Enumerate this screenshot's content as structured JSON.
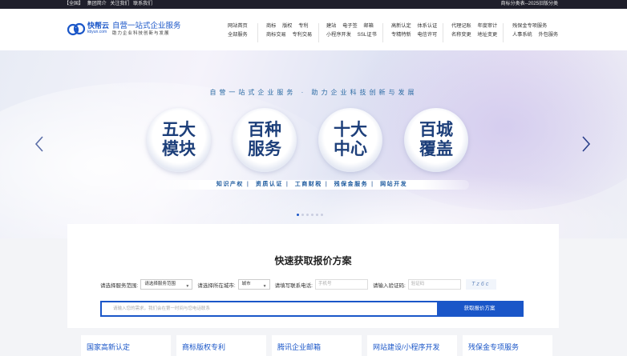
{
  "topbar": {
    "links": [
      "【全国】",
      "集团简介",
      "关注我们",
      "联系我们"
    ],
    "right_text": "商标分类表--2025旧版分类"
  },
  "header": {
    "logo_name": "快帮云",
    "logo_domain": "kbyun.com",
    "tagline_main": "自营一站式企业服务",
    "tagline_sub": "助力企业科技创新与发展",
    "nav": [
      {
        "rows": [
          [
            "网站首页"
          ],
          [
            "全部服务"
          ]
        ]
      },
      {
        "rows": [
          [
            "商标",
            "版权",
            "专利"
          ],
          [
            "商标交易",
            "专利交易"
          ]
        ]
      },
      {
        "rows": [
          [
            "建站",
            "电子签",
            "邮箱"
          ],
          [
            "小程序开发",
            "SSL证书"
          ]
        ]
      },
      {
        "rows": [
          [
            "高新认定",
            "体系认证"
          ],
          [
            "专精特新",
            "电信许可"
          ]
        ]
      },
      {
        "rows": [
          [
            "代理记账",
            "年度审计"
          ],
          [
            "名称变更",
            "地址变更"
          ]
        ]
      },
      {
        "rows": [
          [
            "残保金专项服务"
          ],
          [
            "人事系统",
            "外包服务"
          ]
        ]
      }
    ]
  },
  "banner": {
    "subtitle": "自营一站式企业服务 · 助力企业科技创新与发展",
    "circles": [
      "五大模块",
      "百种服务",
      "十大中心",
      "百城覆盖"
    ],
    "pills": [
      "知识产权",
      "资质认证",
      "工商财税",
      "残保金服务",
      "网站开发"
    ],
    "slide_count": 6,
    "active_slide": 1
  },
  "quote": {
    "title": "快速获取报价方案",
    "service_label": "请选择服务范围:",
    "service_value": "请选择服务范围",
    "city_label": "请选择所在城市:",
    "city_value": "城市",
    "phone_label": "请填写联系电话:",
    "phone_placeholder": "手机号",
    "code_label": "请输入验证码:",
    "code_placeholder": "验证码",
    "captcha_text": "Tz6c",
    "demand_placeholder": "请输入您的需求，我们会在第一时间与您电话联系",
    "submit_label": "获取报价方案"
  },
  "services": [
    "国家高新认定",
    "商标版权专利",
    "腾讯企业邮箱",
    "网站建设/小程序开发",
    "残保金专项服务"
  ]
}
